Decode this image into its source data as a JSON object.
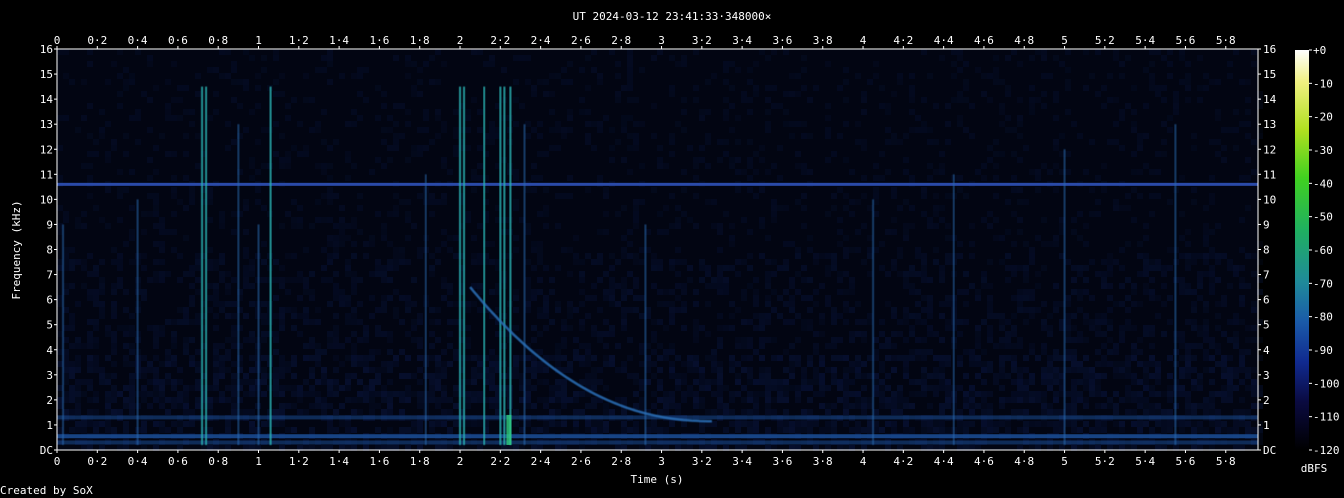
{
  "chart_data": {
    "type": "heatmap",
    "title": "UT 2024-03-12 23:41:33·348000×",
    "xlabel": "Time (s)",
    "ylabel": "Frequency (kHz)",
    "credit": "Created by SoX",
    "x_ticks": [
      "0",
      "0·2",
      "0·4",
      "0·6",
      "0·8",
      "1",
      "1·2",
      "1·4",
      "1·6",
      "1·8",
      "2",
      "2·2",
      "2·4",
      "2·6",
      "2·8",
      "3",
      "3·2",
      "3·4",
      "3·6",
      "3·8",
      "4",
      "4·2",
      "4·4",
      "4·6",
      "4·8",
      "5",
      "5·2",
      "5·4",
      "5·6",
      "5·8"
    ],
    "y_ticks": [
      "DC",
      "1",
      "2",
      "3",
      "4",
      "5",
      "6",
      "7",
      "8",
      "9",
      "10",
      "11",
      "12",
      "13",
      "14",
      "15",
      "16"
    ],
    "xlim": [
      0,
      5.96
    ],
    "ylim": [
      0,
      16
    ],
    "colorbar": {
      "label": "dBFS",
      "ticks": [
        "+0",
        "-10",
        "-20",
        "-30",
        "-40",
        "-50",
        "-60",
        "-70",
        "-80",
        "-90",
        "-100",
        "-110",
        "-120"
      ],
      "range": [
        -120,
        0
      ]
    },
    "features": {
      "carrier_hz_khz": 10.6,
      "low_band_khz": [
        0.3,
        0.55,
        1.3
      ],
      "whistler": {
        "start_time_s": 2.05,
        "start_khz": 6.5,
        "end_time_s": 3.25,
        "end_khz": 1.15
      },
      "sferics_s": [
        0.03,
        0.4,
        0.72,
        0.74,
        0.9,
        1.0,
        1.06,
        1.83,
        2.0,
        2.02,
        2.12,
        2.2,
        2.22,
        2.25,
        2.32,
        2.92,
        4.05,
        4.45,
        5.0,
        5.55
      ]
    },
    "colors": {
      "background": "#000000",
      "noise_floor": "#0a1a4a",
      "carrier": "#2a4aa8",
      "sferic": "#2a6ab0",
      "strong_sferic": "#2ab0b0",
      "axis": "#ffffff"
    }
  }
}
